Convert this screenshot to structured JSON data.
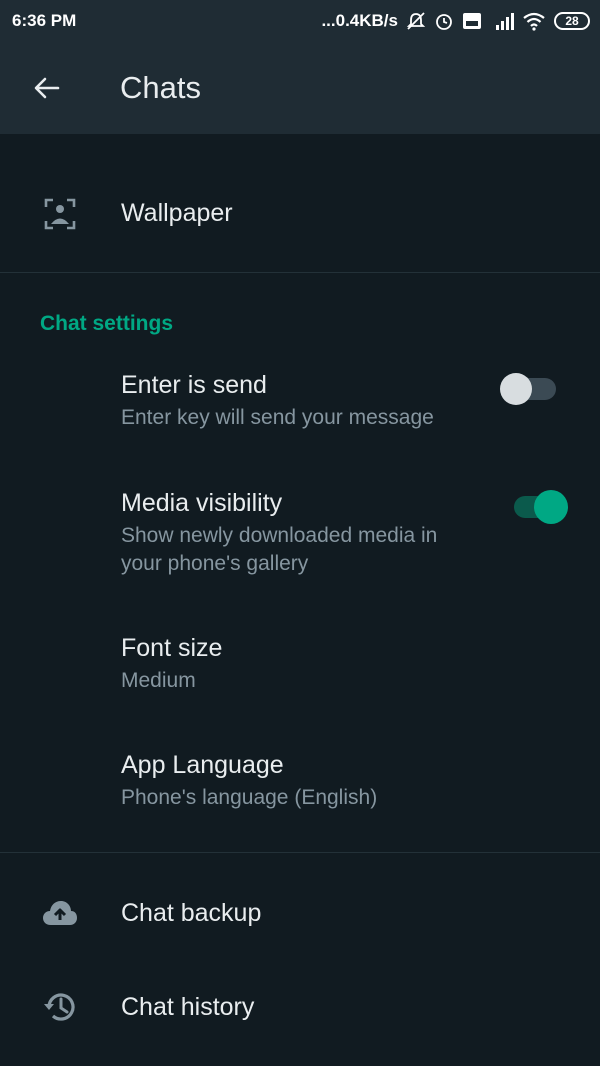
{
  "status_bar": {
    "time": "6:36 PM",
    "network_speed": "...0.4KB/s",
    "battery": "28",
    "icons": [
      "mute-icon",
      "alarm-icon",
      "volte-icon",
      "signal-icon",
      "wifi-icon",
      "battery-icon"
    ]
  },
  "app_bar": {
    "title": "Chats"
  },
  "wallpaper": {
    "title": "Wallpaper"
  },
  "section": {
    "header": "Chat settings"
  },
  "settings": {
    "enter_send": {
      "title": "Enter is send",
      "subtitle": "Enter key will send your message",
      "enabled": false
    },
    "media_visibility": {
      "title": "Media visibility",
      "subtitle_line1": "Show newly downloaded media in",
      "subtitle_line2": "your phone's gallery",
      "enabled": true
    },
    "font_size": {
      "title": "Font size",
      "value": "Medium"
    },
    "app_language": {
      "title": "App Language",
      "value": "Phone's language (English)"
    }
  },
  "chat_backup": {
    "title": "Chat backup"
  },
  "chat_history": {
    "title": "Chat history"
  },
  "colors": {
    "background": "#111b21",
    "bar": "#1f2c34",
    "accent": "#00a884",
    "secondary_text": "#8696a0"
  }
}
